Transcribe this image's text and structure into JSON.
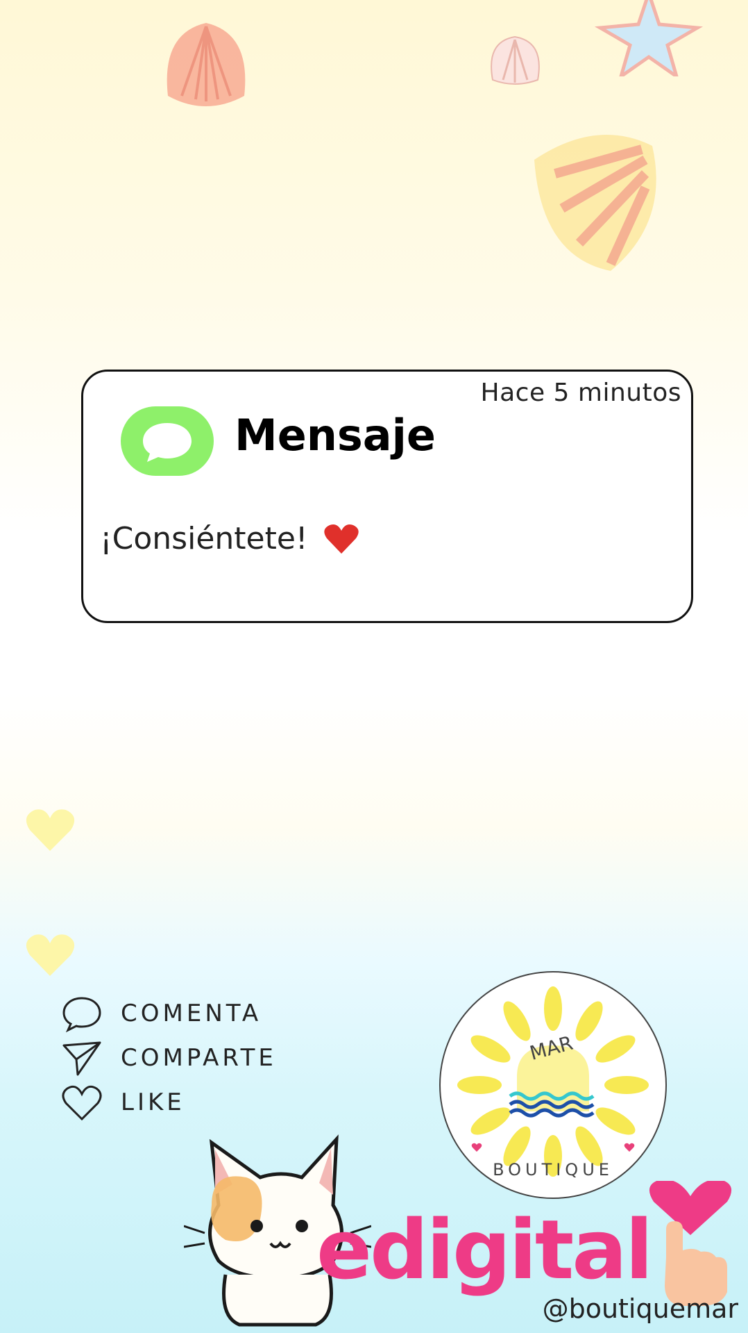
{
  "notification": {
    "time": "Hace 5 minutos",
    "app_name": "Mensaje",
    "message": "¡Consiéntete!",
    "icon": "message-bubble-icon",
    "icon_color": "#8ef06a",
    "heart_icon": "red-heart-icon"
  },
  "actions": [
    {
      "label": "COMENTA",
      "icon": "comment-icon"
    },
    {
      "label": "COMPARTE",
      "icon": "share-icon"
    },
    {
      "label": "LIKE",
      "icon": "heart-outline-icon"
    }
  ],
  "logo": {
    "top_text": "MAR",
    "bottom_text": "BOUTIQUE",
    "sun_color": "#f7e84a",
    "wave_colors": [
      "#35c7ce",
      "#1d4fa8"
    ]
  },
  "branding": {
    "wordmark": "edigital",
    "handle": "@boutiquemar",
    "accent_color": "#ee3b86"
  },
  "decorations": [
    "seashell",
    "starfish",
    "cat-illustration",
    "hearts",
    "pointing-hand"
  ]
}
